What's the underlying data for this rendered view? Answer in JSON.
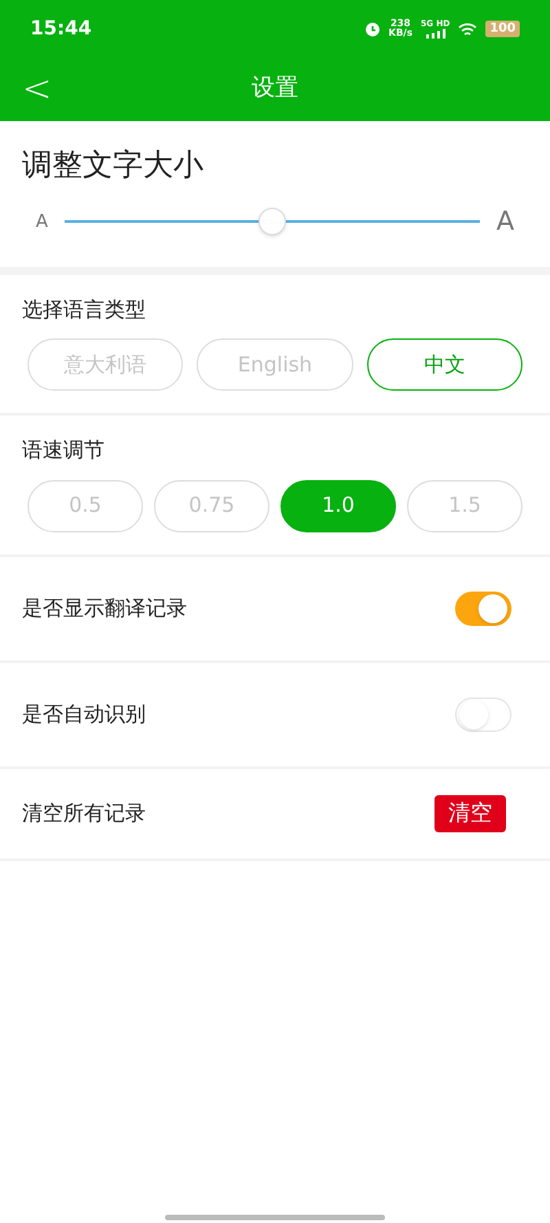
{
  "status_bar": {
    "time": "15:44",
    "speed_value": "238",
    "speed_unit": "KB/s",
    "network": "5G HD",
    "battery": "100"
  },
  "header": {
    "back": "<",
    "title": "设置"
  },
  "font_size": {
    "title": "调整文字大小",
    "small_label": "A",
    "large_label": "A",
    "level": 0.5
  },
  "language": {
    "title": "选择语言类型",
    "options": [
      {
        "label": "意大利语",
        "selected": false
      },
      {
        "label": "English",
        "selected": false
      },
      {
        "label": "中文",
        "selected": true
      }
    ]
  },
  "speed": {
    "title": "语速调节",
    "options": [
      {
        "label": "0.5",
        "selected": false
      },
      {
        "label": "0.75",
        "selected": false
      },
      {
        "label": "1.0",
        "selected": true
      },
      {
        "label": "1.5",
        "selected": false
      }
    ]
  },
  "rows": [
    {
      "kind": "toggle",
      "label": "是否显示翻译记录",
      "on": true
    },
    {
      "kind": "toggle",
      "label": "是否自动识别",
      "on": false
    },
    {
      "kind": "button",
      "label": "清空所有记录",
      "button": "清空"
    }
  ]
}
